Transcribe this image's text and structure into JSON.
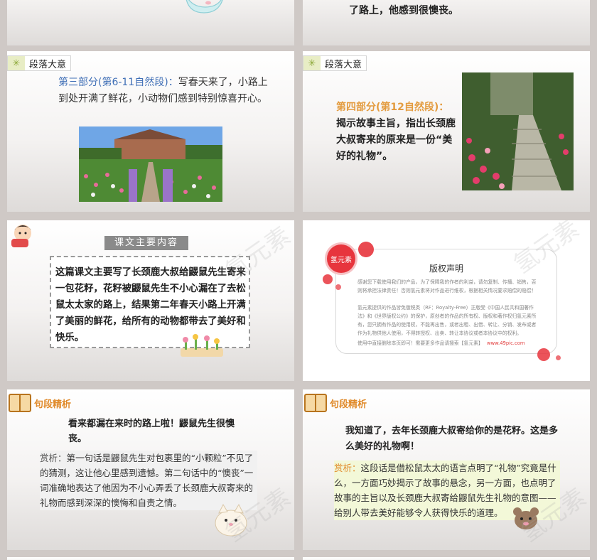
{
  "slide_top_right": {
    "tail": "了路上，他感到很懊丧。"
  },
  "slide3": {
    "tag": "段落大意",
    "lead": "第三部分(第6-11自然段)：",
    "body": "写春天来了，小路上到处开满了鲜花，小动物们感到特别惊喜开心。"
  },
  "slide4": {
    "tag": "段落大意",
    "lead": "第四部分(第12自然段)：",
    "body": "揭示故事主旨，指出长颈鹿大叔寄来的原来是一份“美好的礼物”。"
  },
  "slide5": {
    "banner": "课文主要内容",
    "body": "这篇课文主要写了长颈鹿大叔给鼹鼠先生寄来一包花籽，花籽被鼹鼠先生不小心漏在了去松鼠太太家的路上，结果第二年春天小路上开满了美丽的鲜花，给所有的动物都带去了美好和快乐。"
  },
  "slide6": {
    "badge": "氢元素",
    "title": "版权声明",
    "p1": "感谢您下载使用我们的产品，为了保障我的作者的利益，请勿复制、传播、销售，否则将承担法律责任！否则氢元素将对作品进行维权，根据相关情况要求赔偿的赔偿！",
    "p2": "氢元素提供的作品皆免版税类（RF：Royalty-Free）正版受《中国人民共和国著作法》和《世界版权公约》的保护，原创者的作品的所有权、版权和著作权归氢元素所有，您只拥有作品的使用权，不能再出售，或者出租、出借、转让、分销、发布或者作为礼物供他人使用，不得转授权、出卖、转让本协议或者本协议中的权利。",
    "footer_left": "使用中直接删除本页即可！需要更多作品请搜索【氢元素】",
    "footer_right": "www.49pic.com"
  },
  "slide7": {
    "title": "句段精析",
    "quote": "看来都漏在来时的路上啦！鼹鼠先生很懊丧。",
    "note_lead": "赏析：",
    "note": "第一句话是鼹鼠先生对包裹里的“小颗粒”不见了的猜测，这让他心里感到遗憾。第二句话中的“懊丧”一词准确地表达了他因为不小心弄丢了长颈鹿大叔寄来的礼物而感到深深的懊悔和自责之情。"
  },
  "slide8": {
    "title": "句段精析",
    "quote": "我知道了，去年长颈鹿大叔寄给你的是花籽。这是多么美好的礼物啊！",
    "note_lead": "赏析：",
    "note": "这段话是借松鼠太太的语言点明了“礼物”究竟是什么，一方面巧妙揭示了故事的悬念，另一方面，也点明了故事的主旨以及长颈鹿大叔寄给鼹鼠先生礼物的意图——给别人带去美好能够令人获得快乐的道理。"
  },
  "watermark": "氢元素"
}
